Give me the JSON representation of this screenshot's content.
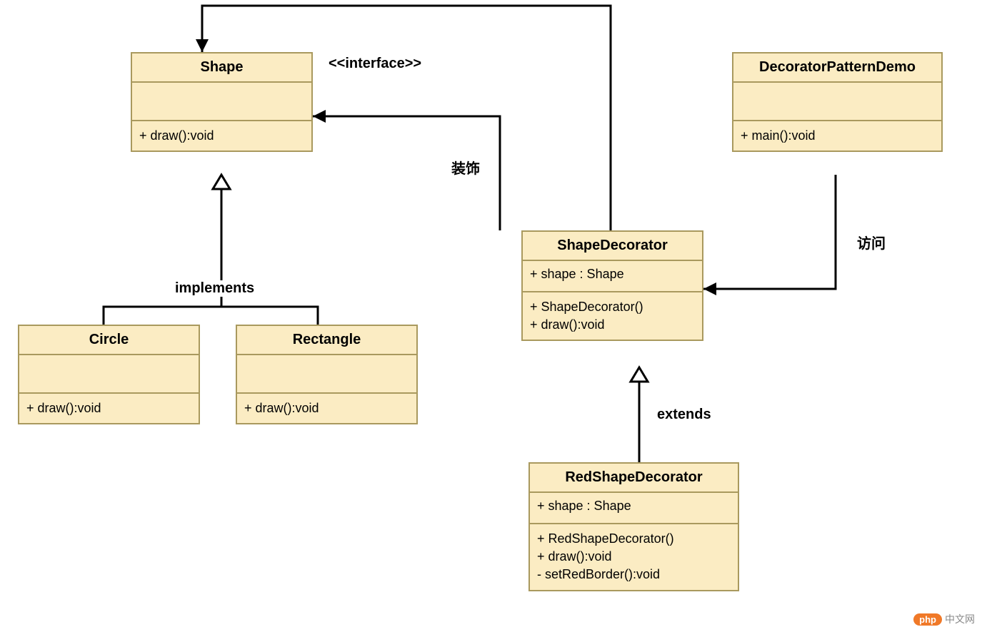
{
  "diagram": {
    "interface_stereotype": "<<interface>>",
    "labels": {
      "implements": "implements",
      "extends": "extends",
      "decorate": "装饰",
      "access": "访问"
    },
    "classes": {
      "shape": {
        "name": "Shape",
        "methods": [
          "+ draw():void"
        ]
      },
      "circle": {
        "name": "Circle",
        "methods": [
          "+ draw():void"
        ]
      },
      "rectangle": {
        "name": "Rectangle",
        "methods": [
          "+ draw():void"
        ]
      },
      "shapeDecorator": {
        "name": "ShapeDecorator",
        "attrs": [
          "+ shape : Shape"
        ],
        "methods": [
          "+ ShapeDecorator()",
          "+ draw():void"
        ]
      },
      "redShapeDecorator": {
        "name": "RedShapeDecorator",
        "attrs": [
          "+ shape : Shape"
        ],
        "methods": [
          "+ RedShapeDecorator()",
          "+ draw():void",
          "- setRedBorder():void"
        ]
      },
      "demo": {
        "name": "DecoratorPatternDemo",
        "methods": [
          "+ main():void"
        ]
      }
    },
    "watermark": {
      "badge": "php",
      "text": "中文网"
    }
  }
}
